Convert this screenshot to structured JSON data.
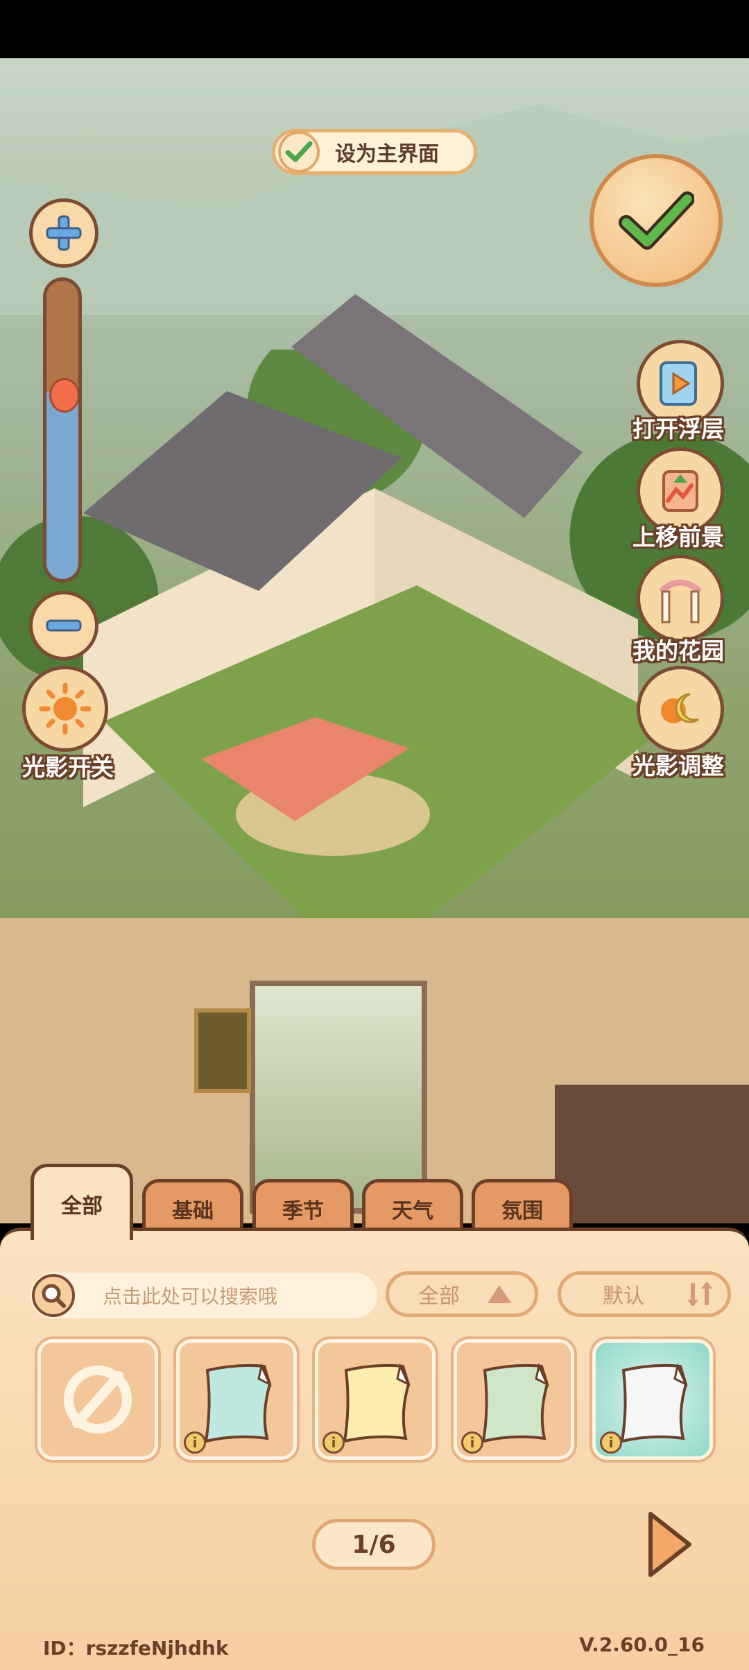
{
  "top": {
    "set_home_label": "设为主界面"
  },
  "side_buttons": [
    {
      "label": "打开浮层",
      "icon": "play-layer-icon"
    },
    {
      "label": "上移前景",
      "icon": "move-foreground-up-icon"
    },
    {
      "label": "我的花园",
      "icon": "garden-arch-icon"
    },
    {
      "label": "光影调整",
      "icon": "sun-moon-icon"
    }
  ],
  "left_controls": {
    "light_toggle_label": "光影开关",
    "zoom_level": 0.75
  },
  "tabs": [
    {
      "label": "全部",
      "active": true
    },
    {
      "label": "基础",
      "active": false
    },
    {
      "label": "季节",
      "active": false
    },
    {
      "label": "天气",
      "active": false
    },
    {
      "label": "氛围",
      "active": false
    }
  ],
  "panel": {
    "search_placeholder": "点击此处可以搜索哦",
    "filter_label": "全部",
    "sort_label": "默认",
    "items": [
      {
        "icon": "none-icon"
      },
      {
        "icon": "paper-note-icon",
        "color": "#bfe8e0"
      },
      {
        "icon": "paper-note-icon",
        "color": "#fbeeb0"
      },
      {
        "icon": "paper-note-icon",
        "color": "#cfe6c9"
      },
      {
        "icon": "paper-note-icon",
        "color": "#f4f7f5"
      }
    ],
    "info_glyph": "i",
    "page": "1/6"
  },
  "footer": {
    "id": "ID：rszzfeNjhdhk",
    "version": "V.2.60.0_16"
  }
}
